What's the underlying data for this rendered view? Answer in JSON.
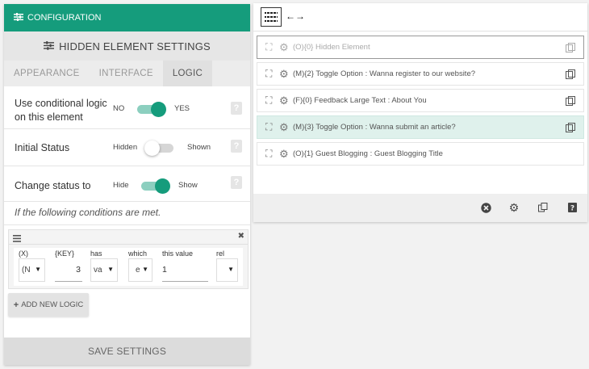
{
  "left_panel": {
    "config_tab": "CONFIGURATION",
    "title": "HIDDEN ELEMENT SETTINGS",
    "subtabs": [
      "APPEARANCE",
      "INTERFACE",
      "LOGIC"
    ],
    "settings": {
      "conditional": {
        "label_line1": "Use conditional logic",
        "label_line2": "on this element",
        "off": "NO",
        "on": "YES",
        "enabled": true
      },
      "initial": {
        "label": "Initial Status",
        "off": "Hidden",
        "on": "Shown",
        "enabled": false
      },
      "change": {
        "label": "Change status to",
        "off": "Hide",
        "on": "Show",
        "enabled": true
      }
    },
    "help_glyph": "?",
    "conditions_text": "If the following conditions are met.",
    "logic": {
      "headers": [
        "(X)",
        "{KEY}",
        "has",
        "which",
        "this value",
        "rel"
      ],
      "values": {
        "x": "(N",
        "key": "3",
        "has": "va",
        "which": "e",
        "this_value": "1",
        "rel": ""
      },
      "close_glyph": "✖"
    },
    "add_logic": "ADD NEW LOGIC",
    "save": "SAVE SETTINGS"
  },
  "right_panel": {
    "items": [
      {
        "text": "(O){0} Hidden Element"
      },
      {
        "text": "(M){2} Toggle Option : Wanna register to our website?"
      },
      {
        "text": "(F){0} Feedback Large Text : About You"
      },
      {
        "text": "(M){3} Toggle Option : Wanna submit an article?"
      },
      {
        "text": "(O){1} Guest Blogging : Guest Blogging Title"
      }
    ],
    "arrows": "←→"
  },
  "icons": {
    "config": "sliders-icon",
    "expand": "fullscreen-icon",
    "gear": "gear-icon",
    "copy": "duplicate-icon",
    "close": "close-circle-icon",
    "help": "help-icon"
  },
  "colors": {
    "accent": "#159c7c",
    "highlight": "#dff1ec"
  }
}
